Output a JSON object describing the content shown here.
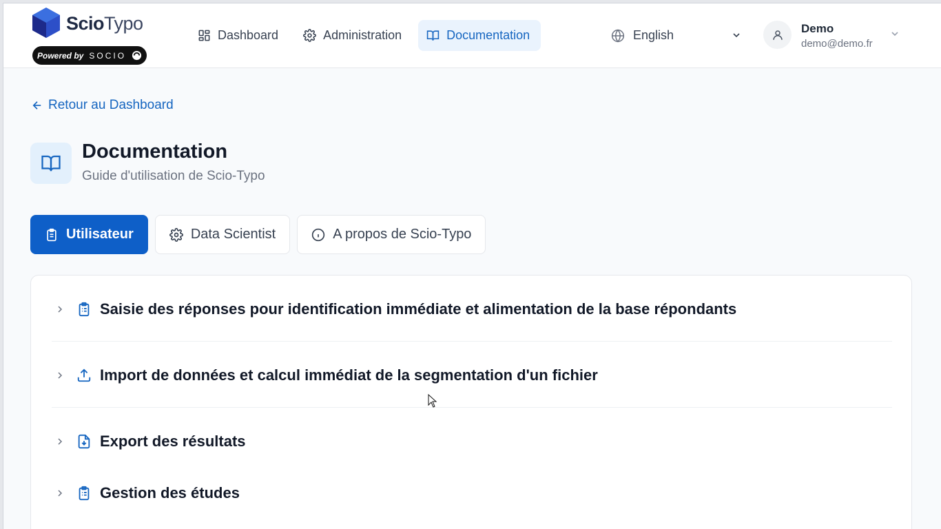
{
  "header": {
    "logo": {
      "brand_bold": "Scio",
      "brand_light": "Typo",
      "powered_by": "Powered by",
      "powered_brand": "SOCIO"
    },
    "nav": [
      {
        "label": "Dashboard",
        "icon": "dashboard-icon",
        "active": false
      },
      {
        "label": "Administration",
        "icon": "gear-icon",
        "active": false
      },
      {
        "label": "Documentation",
        "icon": "book-icon",
        "active": true
      }
    ],
    "language": {
      "value": "English",
      "icon": "globe-icon"
    },
    "user": {
      "name": "Demo",
      "email": "demo@demo.fr",
      "icon": "user-icon"
    }
  },
  "page": {
    "back_link": "Retour au Dashboard",
    "title": "Documentation",
    "subtitle": "Guide d'utilisation de Scio-Typo",
    "tabs": [
      {
        "label": "Utilisateur",
        "icon": "clipboard-icon",
        "active": true
      },
      {
        "label": "Data Scientist",
        "icon": "gear-icon",
        "active": false
      },
      {
        "label": "A propos de Scio-Typo",
        "icon": "info-icon",
        "active": false
      }
    ],
    "sections": [
      {
        "label": "Saisie des réponses pour identification immédiate et alimentation de la base répondants",
        "icon": "clipboard-icon"
      },
      {
        "label": "Import de données et calcul immédiat de la segmentation d'un fichier",
        "icon": "upload-icon"
      },
      {
        "label": "Export des résultats",
        "icon": "file-download-icon"
      },
      {
        "label": "Gestion des études",
        "icon": "clipboard-icon"
      }
    ]
  },
  "colors": {
    "accent": "#0e5fc8",
    "accent_soft": "#eaf3fd",
    "text": "#111827",
    "muted": "#6b7280"
  }
}
